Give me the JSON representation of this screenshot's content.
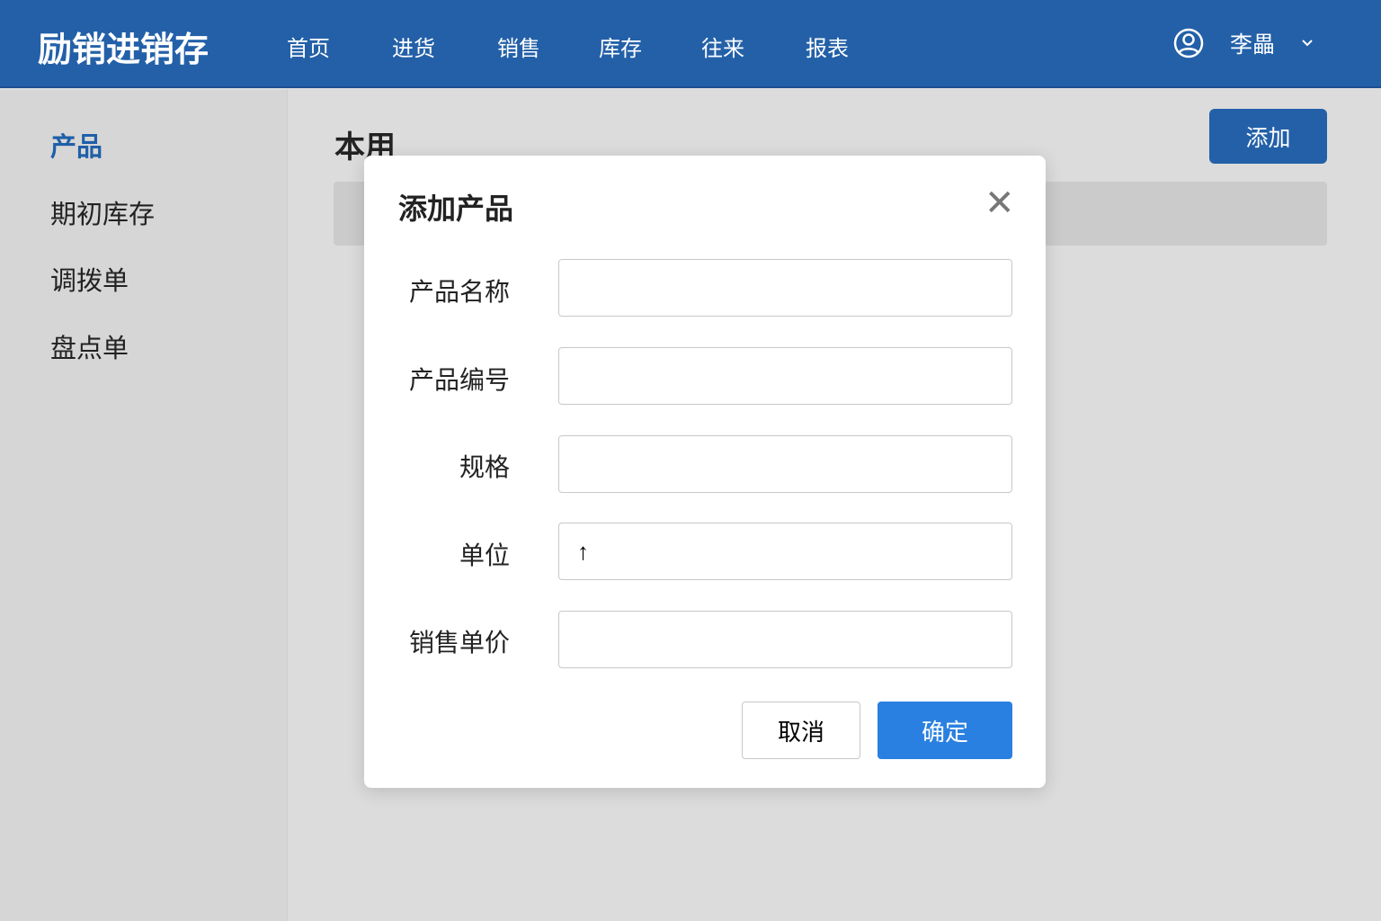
{
  "header": {
    "brand": "励销进销存",
    "nav": [
      "首页",
      "进货",
      "销售",
      "库存",
      "往来",
      "报表"
    ],
    "user": "李畾"
  },
  "sidebar": [
    "产品",
    "期初库存",
    "调拨单",
    "盘点单"
  ],
  "main": {
    "title": "本用",
    "add_label": "添加"
  },
  "modal": {
    "title": "添加产品",
    "fields": [
      {
        "label": "产品名称",
        "value": ""
      },
      {
        "label": "产品编号",
        "value": ""
      },
      {
        "label": "规格",
        "value": ""
      },
      {
        "label": "单位",
        "value": "↑"
      },
      {
        "label": "销售单价",
        "value": ""
      }
    ],
    "cancel": "取消",
    "confirm": "确定"
  },
  "colors": {
    "header": "#2360a8",
    "active": "#1f5fa8",
    "confirm": "#2a80e0"
  }
}
